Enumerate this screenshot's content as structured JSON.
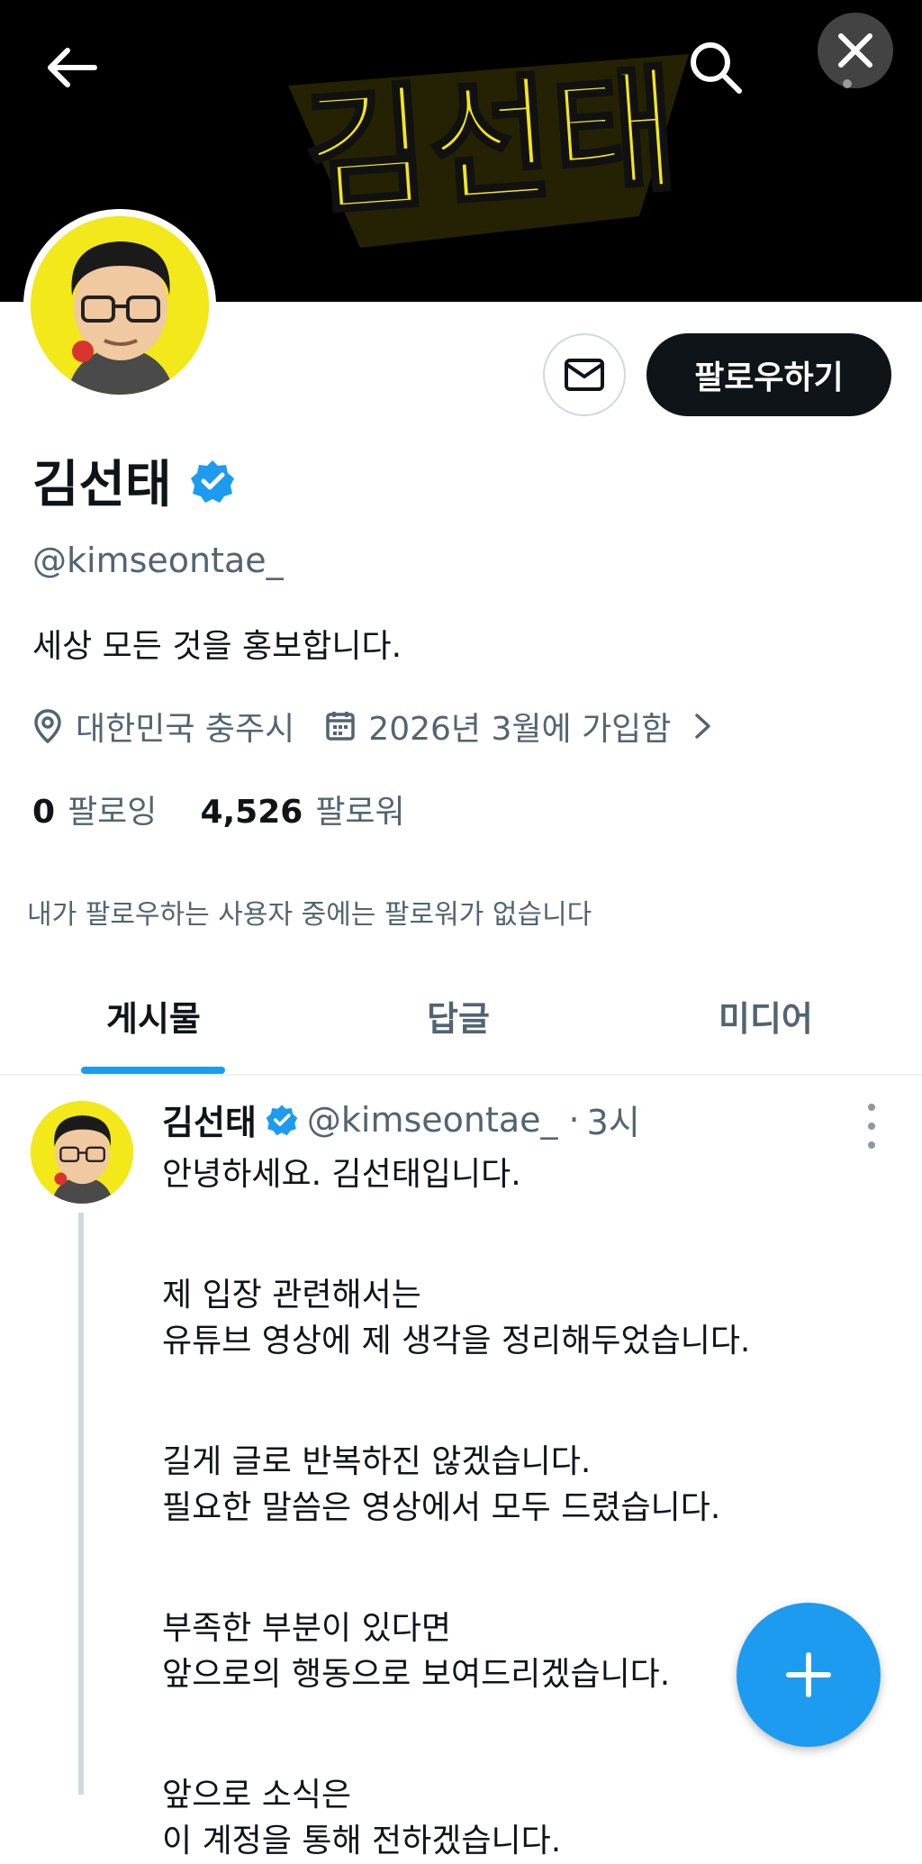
{
  "banner": {
    "logo_text": "김선태",
    "colors": {
      "background": "#000000",
      "logo": "#f5e617"
    }
  },
  "header_icons": {
    "back": "arrow-left-icon",
    "search": "search-icon",
    "close": "close-icon"
  },
  "profile": {
    "name": "김선태",
    "handle": "@kimseontae_",
    "bio": "세상 모든 것을 홍보합니다.",
    "location": "대한민국 충주시",
    "joined": "2026년 3월에 가입함",
    "following_count": "0",
    "following_label": "팔로잉",
    "followers_count": "4,526",
    "followers_label": "팔로워",
    "followed_by_note": "내가 팔로우하는 사용자 중에는 팔로워가 없습니다"
  },
  "actions": {
    "message_icon": "mail-icon",
    "follow_label": "팔로우하기"
  },
  "tabs": [
    {
      "label": "게시물",
      "active": true
    },
    {
      "label": "답글",
      "active": false
    },
    {
      "label": "미디어",
      "active": false
    }
  ],
  "post": {
    "author_name": "김선태",
    "author_handle": "@kimseontae_",
    "separator": "·",
    "time": "3시",
    "paragraphs": [
      [
        "안녕하세요. 김선태입니다."
      ],
      [
        "제 입장 관련해서는",
        "유튜브 영상에 제 생각을 정리해두었습니다."
      ],
      [
        "길게 글로 반복하진 않겠습니다.",
        "필요한 말씀은 영상에서 모두 드렸습니다."
      ],
      [
        "부족한 부분이 있다면",
        "앞으로의 행동으로 보여드리겠습니다."
      ],
      [
        "앞으로 소식은",
        "이 계정을 통해 전하겠습니다."
      ]
    ]
  },
  "fab": {
    "icon": "plus-icon"
  },
  "colors": {
    "accent": "#1d9bf0",
    "text_primary": "#0f1419",
    "text_secondary": "#536471",
    "follow_button": "#0f1419",
    "avatar_background": "#f2e81a"
  }
}
